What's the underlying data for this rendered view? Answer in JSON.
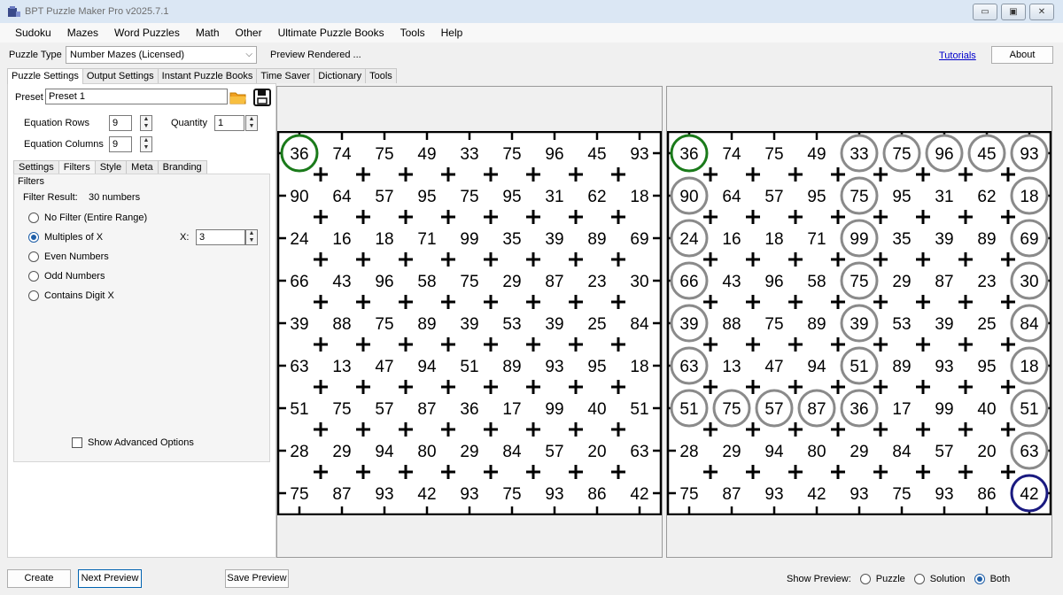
{
  "window": {
    "title": "BPT Puzzle Maker Pro v2025.7.1",
    "controls": {
      "minimize": "▭",
      "maximize": "▣",
      "close": "✕"
    }
  },
  "menu": [
    "Sudoku",
    "Mazes",
    "Word Puzzles",
    "Math",
    "Other",
    "Ultimate Puzzle Books",
    "Tools",
    "Help"
  ],
  "toolbar": {
    "puzzle_type_label": "Puzzle Type",
    "puzzle_type_value": "Number Mazes (Licensed)",
    "status": "Preview Rendered ...",
    "tutorials": "Tutorials",
    "about": "About"
  },
  "main_tabs": [
    "Puzzle Settings",
    "Output Settings",
    "Instant Puzzle Books",
    "Time Saver",
    "Dictionary",
    "Tools"
  ],
  "settings": {
    "preset_label": "Preset",
    "preset_value": "Preset 1",
    "rows_label": "Equation Rows",
    "rows_value": "9",
    "quantity_label": "Quantity",
    "quantity_value": "1",
    "cols_label": "Equation Columns",
    "cols_value": "9"
  },
  "sub_tabs": [
    "Settings",
    "Filters",
    "Style",
    "Meta",
    "Branding"
  ],
  "filters": {
    "group_label": "Filters",
    "result_label": "Filter Result:",
    "result_value": "30 numbers",
    "options": [
      "No Filter (Entire Range)",
      "Multiples of X",
      "Even Numbers",
      "Odd Numbers",
      "Contains Digit X"
    ],
    "selected": 1,
    "x_label": "X:",
    "x_value": "3",
    "advanced_label": "Show Advanced Options"
  },
  "grid": {
    "numbers": [
      [
        36,
        74,
        75,
        49,
        33,
        75,
        96,
        45,
        93
      ],
      [
        90,
        64,
        57,
        95,
        75,
        95,
        31,
        62,
        18
      ],
      [
        24,
        16,
        18,
        71,
        99,
        35,
        39,
        89,
        69
      ],
      [
        66,
        43,
        96,
        58,
        75,
        29,
        87,
        23,
        30
      ],
      [
        39,
        88,
        75,
        89,
        39,
        53,
        39,
        25,
        84
      ],
      [
        63,
        13,
        47,
        94,
        51,
        89,
        93,
        95,
        18
      ],
      [
        51,
        75,
        57,
        87,
        36,
        17,
        99,
        40,
        51
      ],
      [
        28,
        29,
        94,
        80,
        29,
        84,
        57,
        20,
        63
      ],
      [
        75,
        87,
        93,
        42,
        93,
        75,
        93,
        86,
        42
      ]
    ],
    "start": [
      0,
      0
    ],
    "end": [
      8,
      8
    ],
    "start_color": "#1a7a1a",
    "end_color": "#1a1a80",
    "path_color": "#8a8a8a",
    "solution_path": [
      [
        0,
        0
      ],
      [
        1,
        0
      ],
      [
        2,
        0
      ],
      [
        3,
        0
      ],
      [
        4,
        0
      ],
      [
        5,
        0
      ],
      [
        6,
        0
      ],
      [
        6,
        1
      ],
      [
        6,
        2
      ],
      [
        6,
        3
      ],
      [
        6,
        4
      ],
      [
        5,
        4
      ],
      [
        4,
        4
      ],
      [
        3,
        4
      ],
      [
        2,
        4
      ],
      [
        1,
        4
      ],
      [
        0,
        4
      ],
      [
        0,
        5
      ],
      [
        0,
        6
      ],
      [
        0,
        7
      ],
      [
        0,
        8
      ],
      [
        1,
        8
      ],
      [
        2,
        8
      ],
      [
        3,
        8
      ],
      [
        4,
        8
      ],
      [
        5,
        8
      ],
      [
        6,
        8
      ],
      [
        7,
        8
      ],
      [
        8,
        8
      ]
    ]
  },
  "bottom": {
    "create": "Create",
    "next_preview": "Next Preview",
    "save_preview": "Save Preview",
    "show_preview_label": "Show Preview:",
    "preview_options": [
      "Puzzle",
      "Solution",
      "Both"
    ],
    "preview_selected": 2
  }
}
